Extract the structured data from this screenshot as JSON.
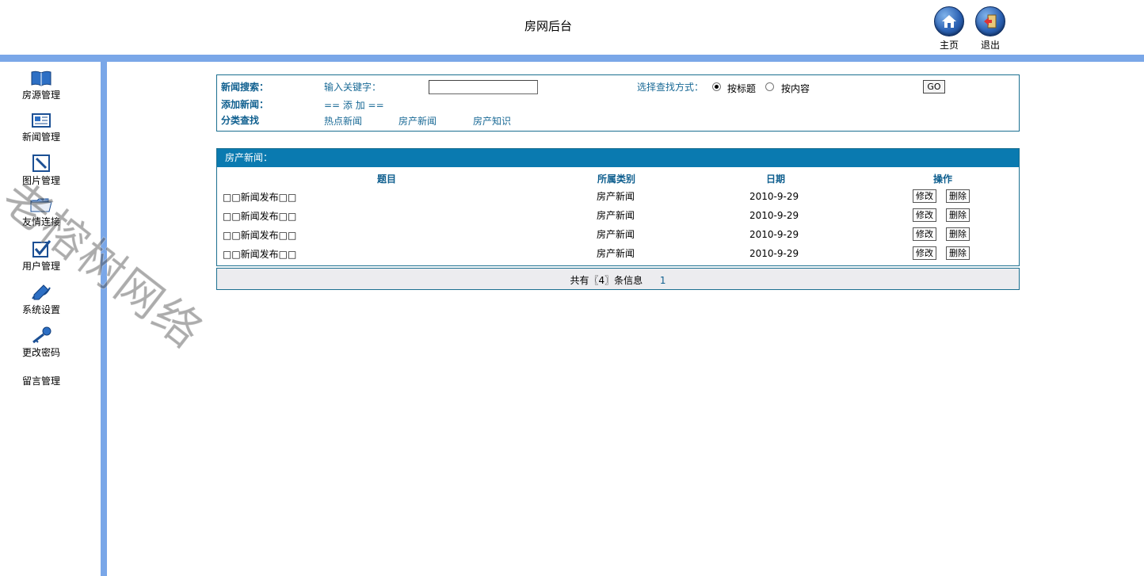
{
  "header": {
    "title": "房网后台",
    "home_label": "主页",
    "logout_label": "退出"
  },
  "sidebar": {
    "items": [
      {
        "label": "房源管理",
        "icon": "book-icon"
      },
      {
        "label": "新闻管理",
        "icon": "news-icon"
      },
      {
        "label": "图片管理",
        "icon": "picture-icon"
      },
      {
        "label": "友情连接",
        "icon": "folder-icon"
      },
      {
        "label": "用户管理",
        "icon": "checkbox-icon"
      },
      {
        "label": "系统设置",
        "icon": "pen-icon"
      },
      {
        "label": "更改密码",
        "icon": "key-icon"
      },
      {
        "label": "留言管理",
        "icon": ""
      }
    ]
  },
  "watermark": "老榕树网络",
  "search": {
    "news_search_label": "新闻搜索：",
    "keyword_label": "输入关键字：",
    "keyword_value": "",
    "method_label": "选择查找方式：",
    "option_title": "按标题",
    "option_content": "按内容",
    "selected": "按标题",
    "go_label": "GO",
    "add_label": "添加新闻：",
    "add_link": "== 添 加 ==",
    "category_label": "分类查找",
    "categories": [
      "热点新闻",
      "房产新闻",
      "房产知识"
    ]
  },
  "news": {
    "section_title": "房产新闻：",
    "columns": [
      "题目",
      "所属类别",
      "日期",
      "操作"
    ],
    "rows": [
      {
        "title": "□□新闻发布□□",
        "category": "房产新闻",
        "date": "2010-9-29"
      },
      {
        "title": "□□新闻发布□□",
        "category": "房产新闻",
        "date": "2010-9-29"
      },
      {
        "title": "□□新闻发布□□",
        "category": "房产新闻",
        "date": "2010-9-29"
      },
      {
        "title": "□□新闻发布□□",
        "category": "房产新闻",
        "date": "2010-9-29"
      }
    ],
    "edit_label": "修改",
    "delete_label": "删除"
  },
  "pager": {
    "summary": "共有〖4〗条信息",
    "page": "1"
  },
  "colors": {
    "bar_blue": "#7aa7e8",
    "header_blue": "#0a7ab0",
    "label_blue": "#0f5f8f"
  }
}
